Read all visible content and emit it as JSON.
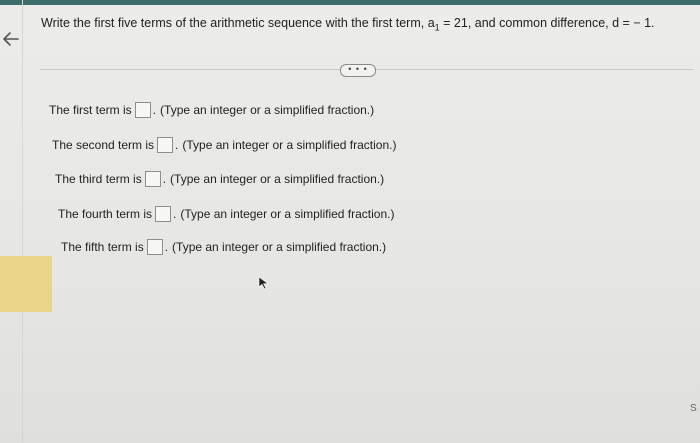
{
  "question": {
    "prefix": "Write the first five terms of the arithmetic sequence with the first term, a",
    "subscript": "1",
    "suffix": " = 21, and common difference, d = − 1."
  },
  "more_button_label": "• • •",
  "rows": [
    {
      "label": "The first term is",
      "hint": "(Type an integer or a simplified fraction.)"
    },
    {
      "label": "The second term is",
      "hint": "(Type an integer or a simplified fraction.)"
    },
    {
      "label": "The third term is",
      "hint": "(Type an integer or a simplified fraction.)"
    },
    {
      "label": "The fourth term is",
      "hint": "(Type an integer or a simplified fraction.)"
    },
    {
      "label": "The fifth term is",
      "hint": "(Type an integer or a simplified fraction.)"
    }
  ],
  "punct": ".",
  "corner_text": "S",
  "colors": {
    "top_bar": "#3c6e6b",
    "left_tab": "#e8d58a"
  },
  "icons": {
    "back": "left-arrow-icon",
    "cursor": "mouse-pointer-icon"
  }
}
